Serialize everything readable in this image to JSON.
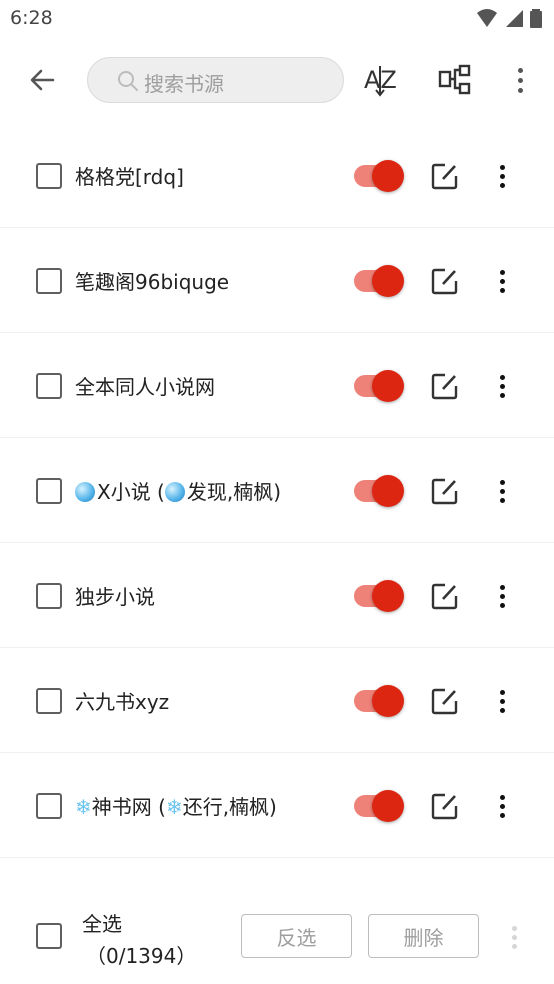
{
  "status_bar": {
    "time": "6:28"
  },
  "toolbar": {
    "search_placeholder": "搜索书源",
    "sort_label": "AZ"
  },
  "sources": [
    {
      "name": "格格党[rdq]",
      "enabled": true
    },
    {
      "name": "笔趣阁96biquge",
      "enabled": true
    },
    {
      "name": "全本同人小说网",
      "enabled": true
    },
    {
      "name_prefix_icon": "crystal-ball-icon",
      "name": "X小说 (",
      "name_mid_icon": "crystal-ball-icon",
      "name_suffix": "发现,楠枫)",
      "enabled": true
    },
    {
      "name": "独步小说",
      "enabled": true
    },
    {
      "name": "六九书xyz",
      "enabled": true
    },
    {
      "name_prefix_icon": "snowflake-icon",
      "name": "神书网 (",
      "name_mid_icon": "snowflake-icon",
      "name_suffix": "还行,楠枫)",
      "enabled": true
    }
  ],
  "bottom_bar": {
    "select_all": "全选",
    "count": "（0/1394）",
    "invert_label": "反选",
    "delete_label": "删除"
  },
  "colors": {
    "switch_thumb": "#dd2612",
    "switch_track": "#ee8278",
    "search_bg": "#eeeeee"
  }
}
